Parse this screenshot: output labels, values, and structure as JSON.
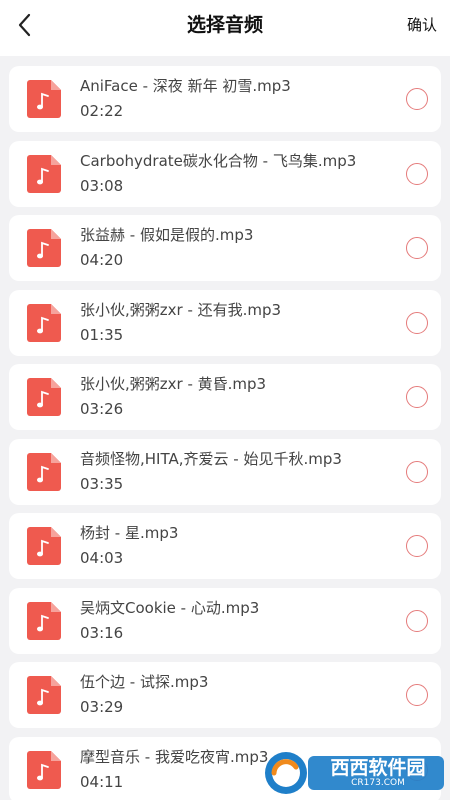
{
  "header": {
    "title": "选择音频",
    "confirm_label": "确认",
    "back_icon": "chevron-left-icon"
  },
  "files": [
    {
      "name": "AniFace - 深夜 新年 初雪.mp3",
      "duration": "02:22",
      "selected": false
    },
    {
      "name": "Carbohydrate碳水化合物 - 飞鸟集.mp3",
      "duration": "03:08",
      "selected": false
    },
    {
      "name": "张益赫 - 假如是假的.mp3",
      "duration": "04:20",
      "selected": false
    },
    {
      "name": "张小伙,粥粥zxr - 还有我.mp3",
      "duration": "01:35",
      "selected": false
    },
    {
      "name": "张小伙,粥粥zxr - 黄昏.mp3",
      "duration": "03:26",
      "selected": false
    },
    {
      "name": "音频怪物,HITA,齐爱云 - 始见千秋.mp3",
      "duration": "03:35",
      "selected": false
    },
    {
      "name": "杨封 - 星.mp3",
      "duration": "04:03",
      "selected": false
    },
    {
      "name": "吴炳文Cookie - 心动.mp3",
      "duration": "03:16",
      "selected": false
    },
    {
      "name": "伍个边 - 试探.mp3",
      "duration": "03:29",
      "selected": false
    },
    {
      "name": "摩型音乐 - 我爱吃夜宵.mp3",
      "duration": "04:11",
      "selected": false
    }
  ],
  "watermark": {
    "brand": "西西软件园",
    "domain": "CR173.COM"
  },
  "colors": {
    "accent": "#ef5a4f",
    "radio_border": "#e57b7b",
    "background": "#f2f2f4",
    "card": "#ffffff"
  }
}
